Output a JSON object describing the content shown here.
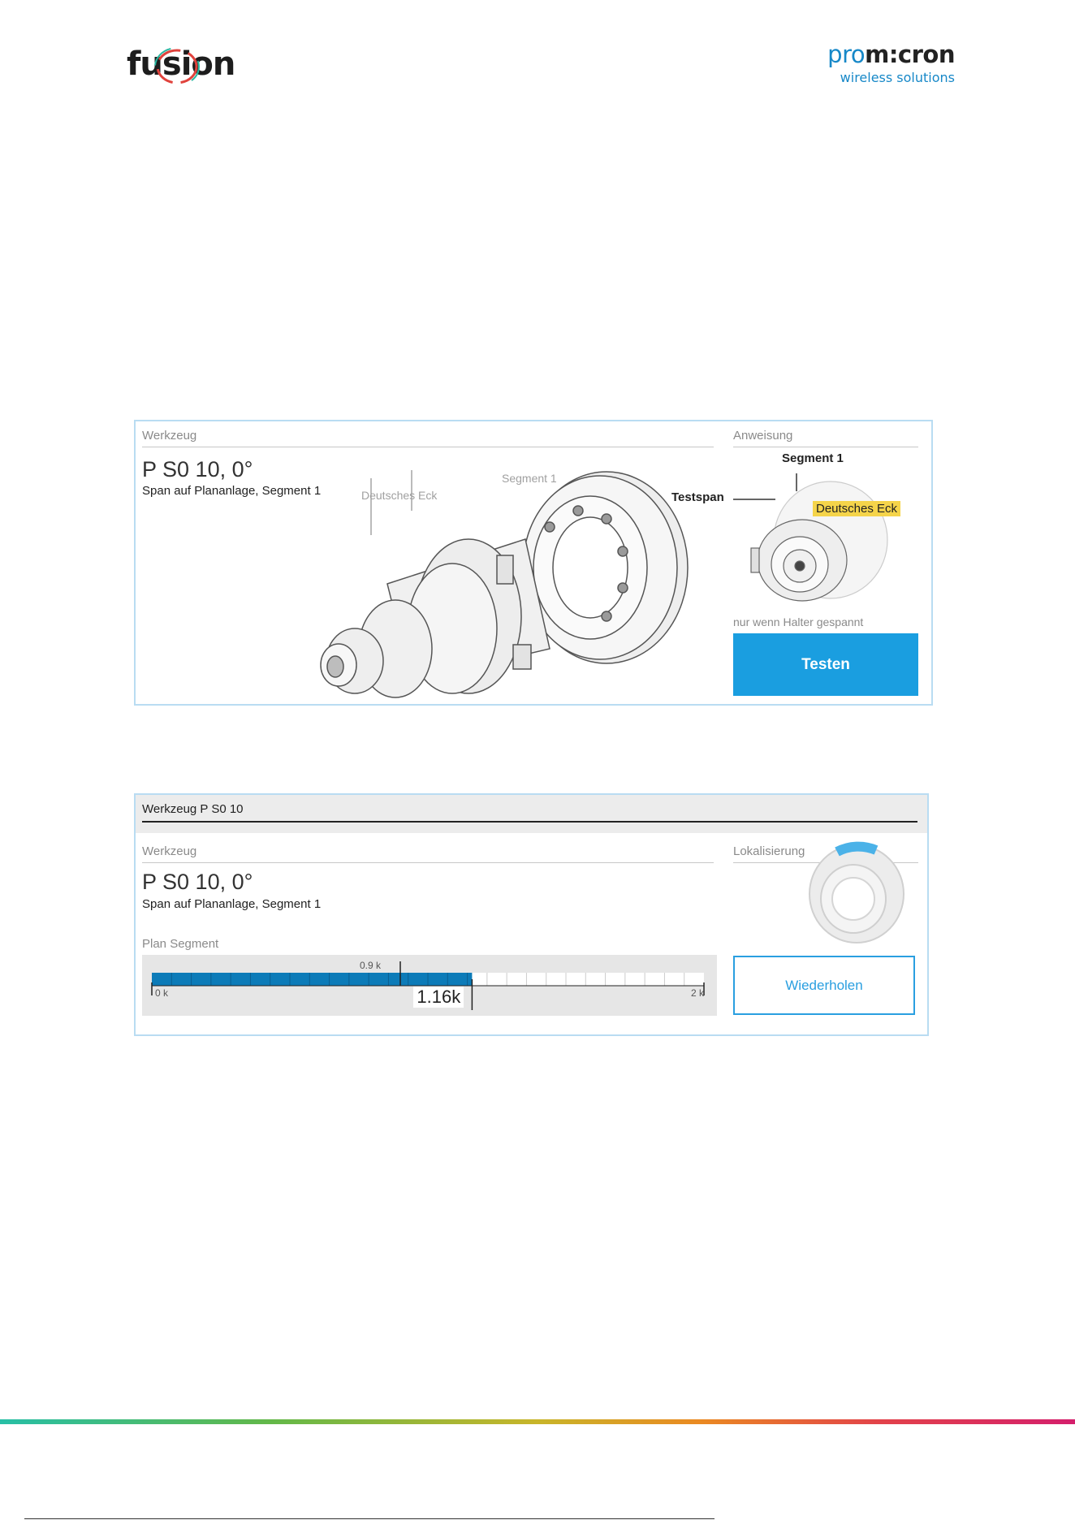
{
  "header": {
    "left_logo": "fusion",
    "right_logo_part1": "pro",
    "right_logo_part2": "m:cron",
    "right_logo_sub": "wireless solutions"
  },
  "panel1": {
    "werkzeug_label": "Werkzeug",
    "tool_name": "P S0 10, 0°",
    "tool_desc": "Span auf Plananlage, Segment 1",
    "callout_deutsches_eck": "Deutsches Eck",
    "callout_segment": "Segment 1",
    "anweisung_label": "Anweisung",
    "anweisung_segment": "Segment 1",
    "anweisung_testspan": "Testspan",
    "anweisung_deutsches_eck": "Deutsches Eck",
    "hint": "nur wenn Halter gespannt",
    "button_label": "Testen"
  },
  "panel2": {
    "header_title": "Werkzeug P S0 10",
    "werkzeug_label": "Werkzeug",
    "tool_name": "P S0 10, 0°",
    "tool_desc": "Span auf Plananlage, Segment 1",
    "lokalisierung_label": "Lokalisierung",
    "plan_segment_label": "Plan Segment",
    "gauge": {
      "min_label": "0 k",
      "max_label": "2 k",
      "threshold_label": "0.9 k",
      "value_label": "1.16k",
      "min": 0,
      "max": 2000,
      "threshold": 900,
      "value": 1160
    },
    "button_label": "Wiederholen"
  },
  "colors": {
    "accent": "#1a9ee0",
    "panel_border": "#b9dcf2",
    "gauge_fill": "#0c7bb8",
    "highlight": "#f5d44a"
  }
}
